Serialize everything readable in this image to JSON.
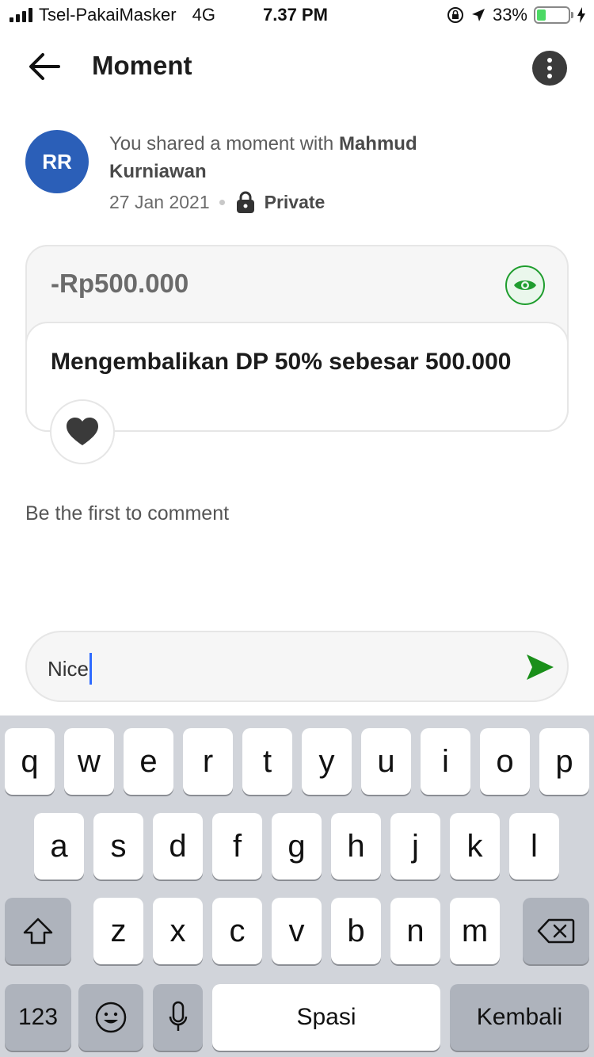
{
  "status_bar": {
    "carrier": "Tsel-PakaiMasker",
    "network": "4G",
    "time": "7.37 PM",
    "battery": "33%"
  },
  "header": {
    "title": "Moment",
    "back_icon": "arrow-left-icon",
    "more_icon": "more-vertical-icon"
  },
  "moment": {
    "avatar_initials": "RR",
    "avatar_color": "#2b5fb8",
    "shared_text": "You shared a moment with ",
    "shared_with": "Mahmud Kurniawan",
    "date": "27 Jan 2021",
    "privacy": "Private"
  },
  "transaction": {
    "amount": "-Rp500.000",
    "description": "Mengembalikan DP 50% sebesar 500.000",
    "accent_color": "#1f9d2e"
  },
  "comments": {
    "empty_text": "Be the first to comment",
    "input_value": "Nice"
  },
  "keyboard": {
    "row1": [
      "q",
      "w",
      "e",
      "r",
      "t",
      "y",
      "u",
      "i",
      "o",
      "p"
    ],
    "row2": [
      "a",
      "s",
      "d",
      "f",
      "g",
      "h",
      "j",
      "k",
      "l"
    ],
    "row3": [
      "z",
      "x",
      "c",
      "v",
      "b",
      "n",
      "m"
    ],
    "numbers_label": "123",
    "space_label": "Spasi",
    "return_label": "Kembali"
  }
}
